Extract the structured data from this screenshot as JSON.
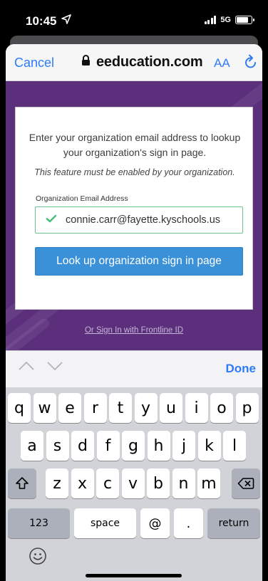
{
  "status_bar": {
    "time": "10:45",
    "network": "5G",
    "location_icon": "location-arrow-icon",
    "battery_level": 0.8
  },
  "browser": {
    "cancel_label": "Cancel",
    "url": "eeducation.com",
    "aa_label": "AA",
    "lock_icon": "lock-icon",
    "reload_icon": "reload-icon"
  },
  "card": {
    "instructions": "Enter your organization email address to lookup your organization's sign in page.",
    "note": "This feature must be enabled by your organization.",
    "email_label": "Organization Email Address",
    "email_value": "connie.carr@fayette.kyschools.us",
    "lookup_button": "Look up organization sign in page"
  },
  "alt_link": "Or Sign In with Frontline ID",
  "accessory": {
    "done_label": "Done"
  },
  "keyboard": {
    "row1": [
      "q",
      "w",
      "e",
      "r",
      "t",
      "y",
      "u",
      "i",
      "o",
      "p"
    ],
    "row2": [
      "a",
      "s",
      "d",
      "f",
      "g",
      "h",
      "j",
      "k",
      "l"
    ],
    "row3": [
      "z",
      "x",
      "c",
      "v",
      "b",
      "n",
      "m"
    ],
    "numbers_label": "123",
    "space_label": "space",
    "at_label": "@",
    "dot_label": ".",
    "return_label": "return"
  },
  "colors": {
    "accent": "#2f7bf5",
    "page_background": "#5b2f7c",
    "button": "#3a91d8",
    "valid": "#6cc58f"
  }
}
